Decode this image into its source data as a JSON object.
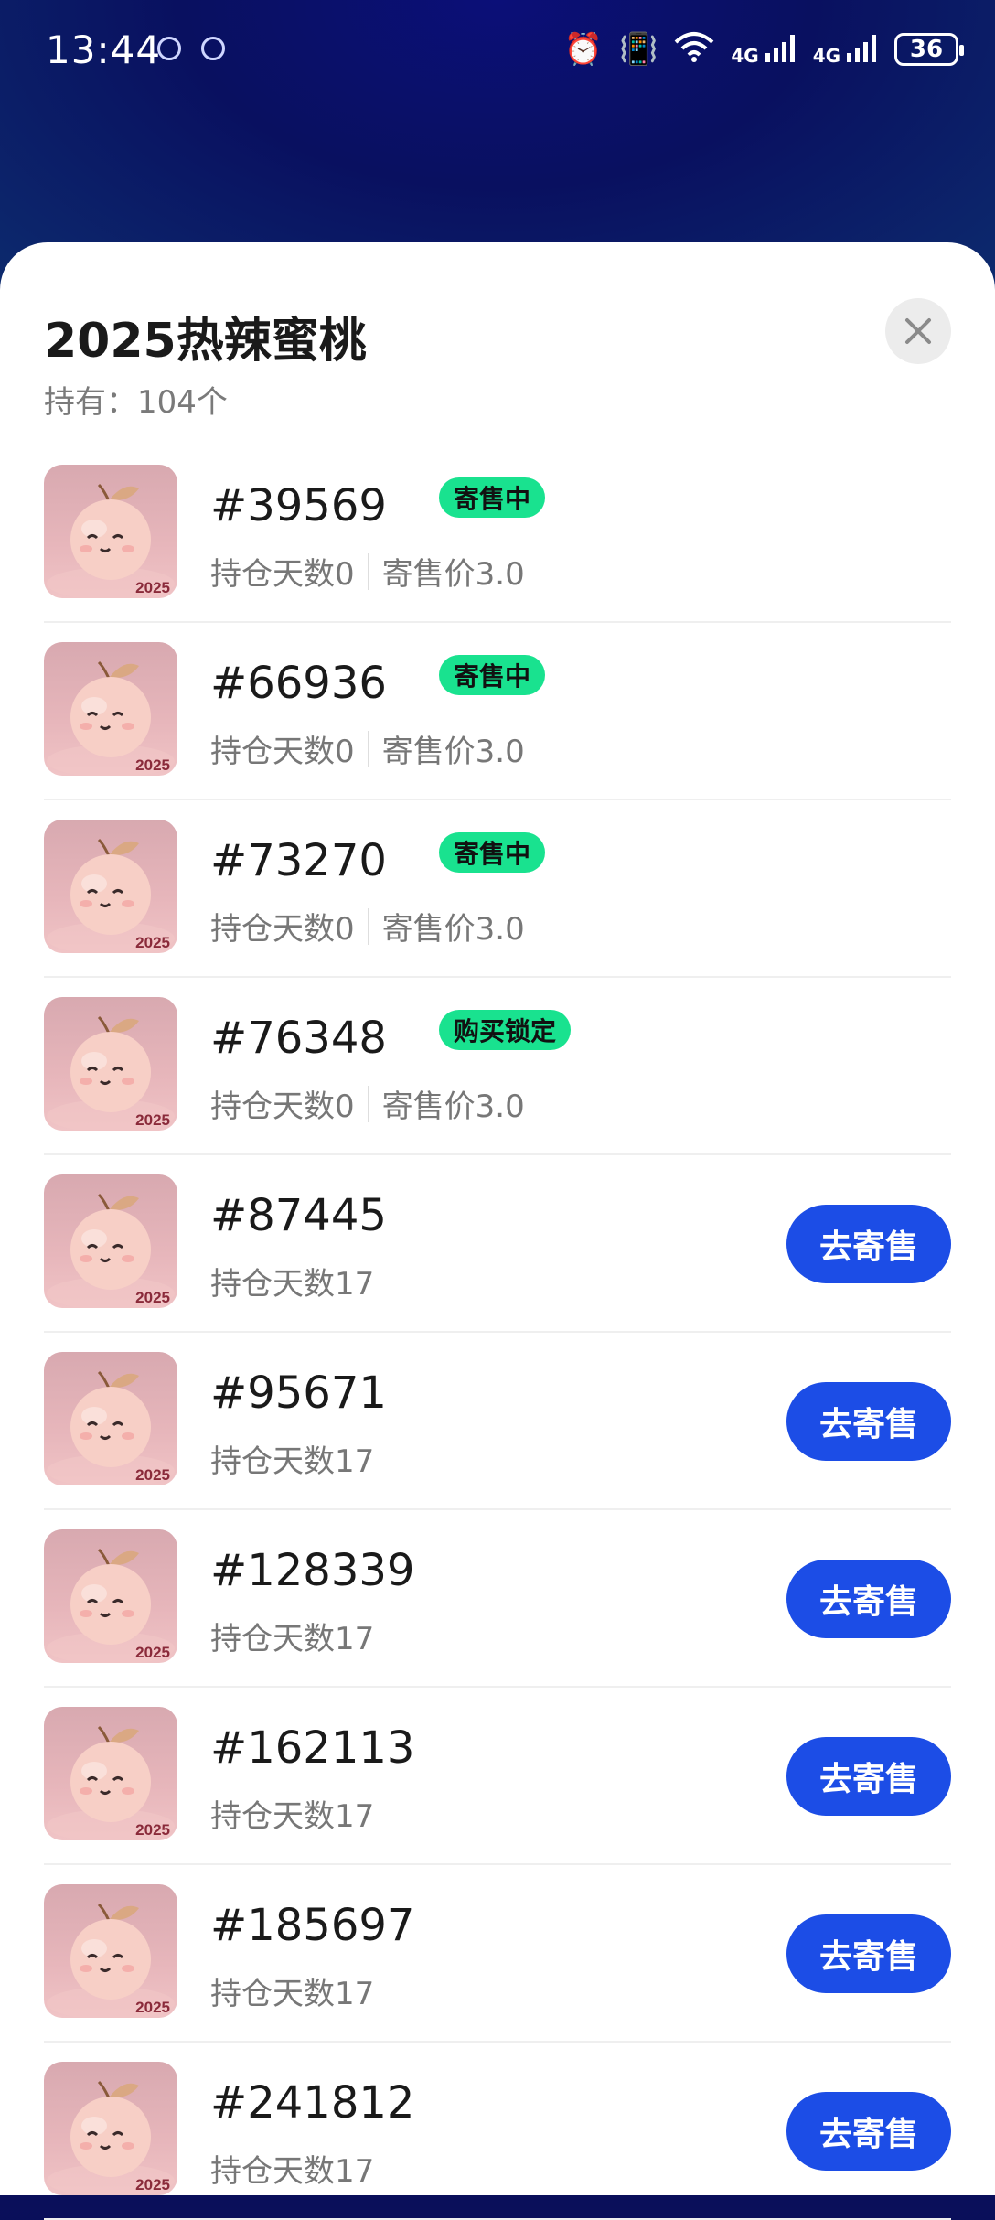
{
  "status_bar": {
    "time": "13:44",
    "signal1": "4G",
    "signal2": "4G",
    "battery": "36"
  },
  "sheet": {
    "title": "2025热辣蜜桃",
    "holding": "持有：104个"
  },
  "items": [
    {
      "id": "#39569",
      "badge": "寄售中",
      "days": "持仓天数0",
      "price": "寄售价3.0",
      "action": ""
    },
    {
      "id": "#66936",
      "badge": "寄售中",
      "days": "持仓天数0",
      "price": "寄售价3.0",
      "action": ""
    },
    {
      "id": "#73270",
      "badge": "寄售中",
      "days": "持仓天数0",
      "price": "寄售价3.0",
      "action": ""
    },
    {
      "id": "#76348",
      "badge": "购买锁定",
      "days": "持仓天数0",
      "price": "寄售价3.0",
      "action": ""
    },
    {
      "id": "#87445",
      "badge": "",
      "days": "持仓天数17",
      "price": "",
      "action": "去寄售"
    },
    {
      "id": "#95671",
      "badge": "",
      "days": "持仓天数17",
      "price": "",
      "action": "去寄售"
    },
    {
      "id": "#128339",
      "badge": "",
      "days": "持仓天数17",
      "price": "",
      "action": "去寄售"
    },
    {
      "id": "#162113",
      "badge": "",
      "days": "持仓天数17",
      "price": "",
      "action": "去寄售"
    },
    {
      "id": "#185697",
      "badge": "",
      "days": "持仓天数17",
      "price": "",
      "action": "去寄售"
    },
    {
      "id": "#241812",
      "badge": "",
      "days": "持仓天数17",
      "price": "",
      "action": "去寄售"
    }
  ],
  "thumb_label": "2025",
  "colors": {
    "badge": "#19e28f",
    "button": "#1c4de6"
  }
}
